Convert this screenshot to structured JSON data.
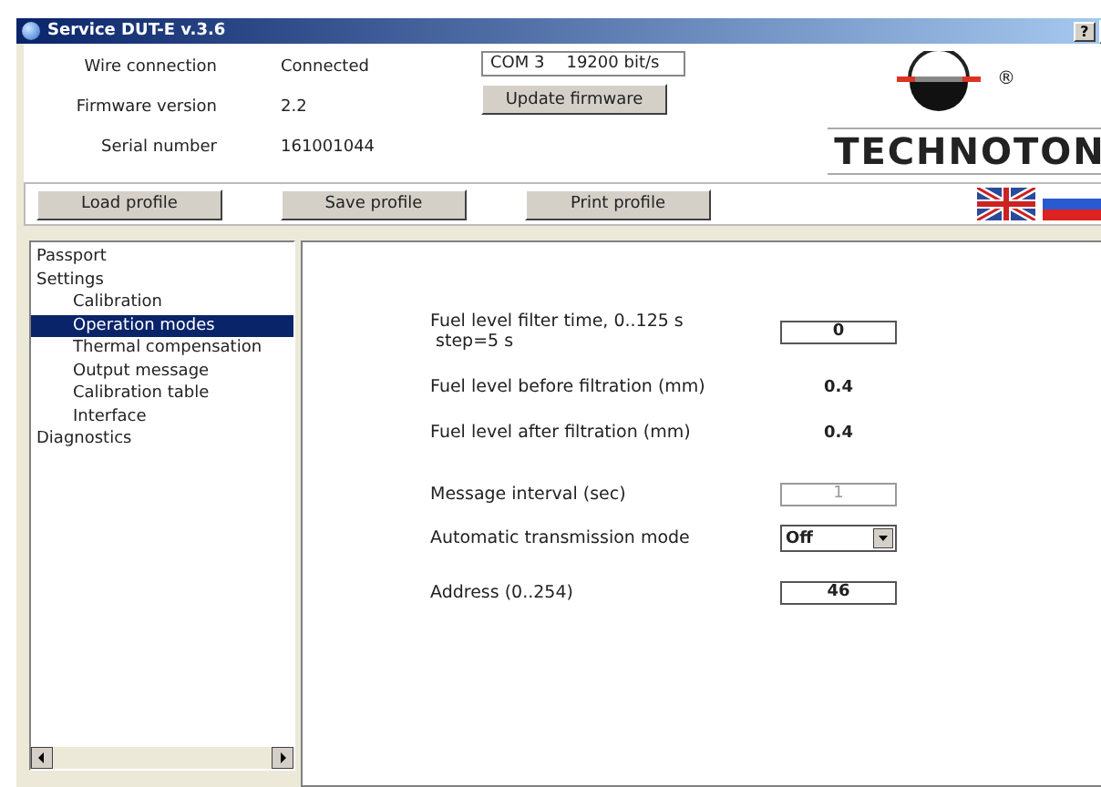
{
  "window": {
    "title": "Service DUT-E  v.3.6",
    "help_button": "?"
  },
  "info": [
    {
      "label": "Wire connection",
      "value": "Connected"
    },
    {
      "label": "Firmware version",
      "value": "2.2"
    },
    {
      "label": "Serial number",
      "value": "161001044"
    }
  ],
  "port": {
    "port": "COM 3",
    "speed": "19200 bit/s"
  },
  "update_button": "Update firmware",
  "logo": {
    "brand": "TECHNOTON",
    "registered": "®"
  },
  "profile_buttons": [
    "Load profile",
    "Save profile",
    "Print profile"
  ],
  "languages": [
    {
      "kind": "uk",
      "selected": false
    },
    {
      "kind": "ru",
      "selected": false
    }
  ],
  "tree": [
    {
      "label": "Passport",
      "selected": false
    },
    {
      "label": "Settings",
      "selected": false,
      "children": [
        {
          "label": "Calibration",
          "selected": false
        },
        {
          "label": "Operation modes",
          "selected": true
        },
        {
          "label": "Thermal compensation",
          "selected": false
        },
        {
          "label": "Output message",
          "selected": false
        },
        {
          "label": "Calibration table",
          "selected": false
        },
        {
          "label": "Interface",
          "selected": false
        }
      ]
    },
    {
      "label": "Diagnostics",
      "selected": false
    }
  ],
  "settings": [
    {
      "kind": "input",
      "label": "Fuel level filter time, 0..125 s\n step=5 s",
      "value": "0",
      "disabled": false
    },
    {
      "kind": "reading",
      "label": "Fuel level before filtration (mm)",
      "value": "0.4"
    },
    {
      "kind": "reading",
      "label": "Fuel level after filtration (mm)",
      "value": "0.4"
    },
    {
      "kind": "input",
      "label": "Message interval (sec)",
      "value": "1",
      "disabled": true
    },
    {
      "kind": "select",
      "label": "Automatic transmission mode",
      "value": "Off"
    },
    {
      "kind": "input",
      "label": "Address (0..254)",
      "value": "46",
      "disabled": false
    }
  ]
}
